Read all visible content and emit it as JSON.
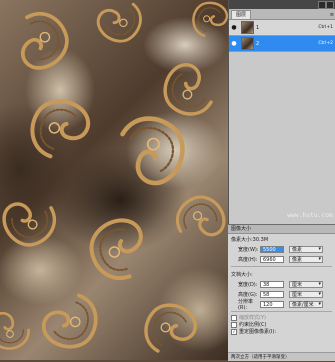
{
  "layers_panel": {
    "tabs": [
      "图层"
    ],
    "menu_glyph": "≡",
    "layers": [
      {
        "name": "1",
        "shortcut": "Ctrl+1",
        "selected": false
      },
      {
        "name": "2",
        "shortcut": "Ctrl+2",
        "selected": true
      }
    ]
  },
  "watermark": "www.hutu.com",
  "dialog": {
    "title": "图像大小",
    "pixel_group": "像素大小:30.3M",
    "pixel_fields": [
      {
        "label": "宽度(W):",
        "value": "5500",
        "unit": "像素"
      },
      {
        "label": "高度(H):",
        "value": "6960",
        "unit": "像素"
      }
    ],
    "doc_group": "文档大小:",
    "doc_fields": [
      {
        "label": "宽度(D):",
        "value": "38",
        "unit": "厘米"
      },
      {
        "label": "高度(G):",
        "value": "58",
        "unit": "厘米"
      },
      {
        "label": "分辨率(R):",
        "value": "120",
        "unit": "像素/厘米"
      }
    ],
    "checks": [
      {
        "label": "缩放样式(Y)",
        "checked": false,
        "disabled": true
      },
      {
        "label": "约束比例(C)",
        "checked": false,
        "disabled": false
      },
      {
        "label": "重定图像像素(I):",
        "checked": true,
        "disabled": false
      }
    ],
    "footer": "两次立方（适用于平滑渐变）"
  },
  "colors": {
    "selection_blue": "#2f8bf0",
    "panel_gray": "#c7c7c7",
    "artwork_gold": "#c89a5a"
  }
}
